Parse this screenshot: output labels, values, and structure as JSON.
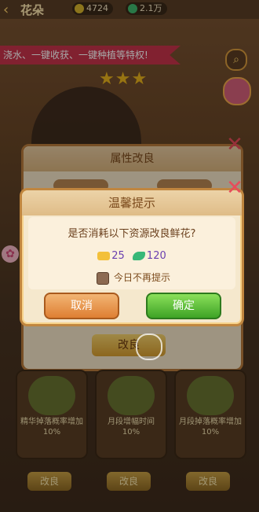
{
  "header": {
    "back_icon": "back-arrow-icon",
    "title": "花朵",
    "resource1_value": "4724",
    "resource2_value": "2.1万"
  },
  "banner_text": "浇水、一键收获、一键种植等特权!",
  "stars": {
    "filled": 3,
    "total": 3
  },
  "back_panel": {
    "title": "属性改良",
    "improve_label": "改良"
  },
  "cards": [
    {
      "text": "精华掉落概率增加10%"
    },
    {
      "text": "月段增幅时间10%"
    },
    {
      "text": "月段掉落概率增加10%"
    }
  ],
  "card_buttons": [
    "改良",
    "改良",
    "改良"
  ],
  "dialog": {
    "title": "温馨提示",
    "question": "是否消耗以下资源改良鲜花?",
    "coin_cost": "25",
    "leaf_cost": "120",
    "checkbox_label": "今日不再提示",
    "cancel_label": "取消",
    "confirm_label": "确定"
  },
  "colors": {
    "accent_gold": "#e8b21c",
    "cancel_orange": "#de7f33",
    "confirm_green": "#3ea326",
    "close_red": "#e84b5a"
  }
}
